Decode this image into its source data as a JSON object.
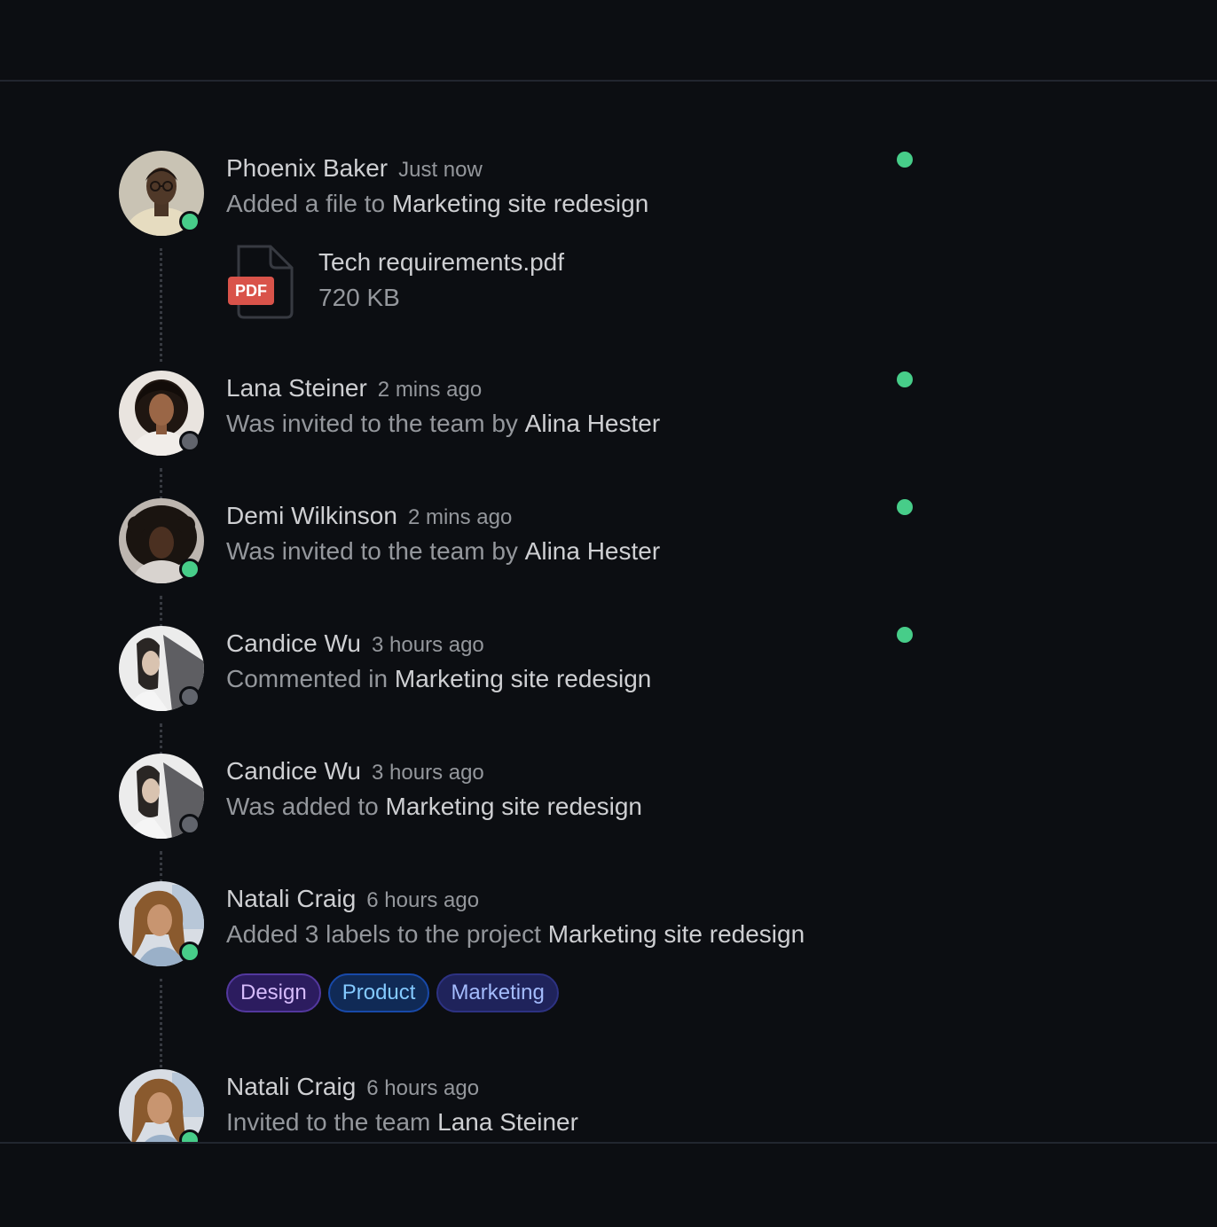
{
  "feed": {
    "items": [
      {
        "name": "Phoenix Baker",
        "time": "Just now",
        "action": "Added a file to ",
        "target": "Marketing site redesign",
        "status": "online",
        "unread": true,
        "file": {
          "type_label": "PDF",
          "name": "Tech requirements.pdf",
          "size": "720 KB"
        }
      },
      {
        "name": "Lana Steiner",
        "time": "2 mins ago",
        "action": "Was invited to the team by ",
        "target": "Alina Hester",
        "status": "offline",
        "unread": true
      },
      {
        "name": "Demi Wilkinson",
        "time": "2 mins ago",
        "action": "Was invited to the team by ",
        "target": "Alina Hester",
        "status": "online",
        "unread": true
      },
      {
        "name": "Candice Wu",
        "time": "3 hours ago",
        "action": "Commented in ",
        "target": "Marketing site redesign",
        "status": "offline",
        "unread": true
      },
      {
        "name": "Candice Wu",
        "time": "3 hours ago",
        "action": "Was added to ",
        "target": "Marketing site redesign",
        "status": "offline",
        "unread": false
      },
      {
        "name": "Natali Craig",
        "time": "6 hours ago",
        "action": "Added 3 labels to the project ",
        "target": "Marketing site redesign",
        "status": "online",
        "unread": false,
        "labels": [
          "Design",
          "Product",
          "Marketing"
        ]
      },
      {
        "name": "Natali Craig",
        "time": "6 hours ago",
        "action": "Invited to the team ",
        "target": "Lana Steiner",
        "status": "online",
        "unread": false
      }
    ]
  },
  "colors": {
    "background": "#0c0e12",
    "online": "#47cd89",
    "offline": "#61646c",
    "pdf_badge": "#d9534a",
    "label_design": "#53389e",
    "label_product": "#1849a9",
    "label_marketing": "#2d3282"
  }
}
